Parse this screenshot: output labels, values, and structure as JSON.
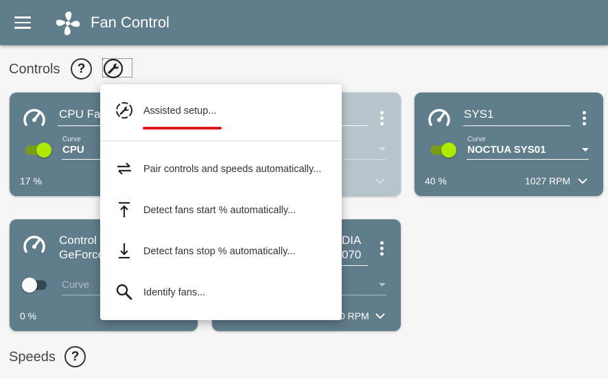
{
  "app": {
    "title": "Fan Control"
  },
  "sections": {
    "controls": "Controls",
    "speeds": "Speeds"
  },
  "help_glyph": "?",
  "cards": [
    {
      "name": "CPU Fan",
      "caption": "Curve",
      "curve": "CPU",
      "percent": "17 %",
      "rpm": "",
      "enabled": true
    },
    {
      "name": "",
      "caption": "",
      "curve": "",
      "percent": "",
      "rpm": "",
      "enabled": true
    },
    {
      "name": "SYS1",
      "caption": "Curve",
      "curve": "NOCTUA SYS01",
      "percent": "40 %",
      "rpm": "1027 RPM",
      "enabled": true
    },
    {
      "name_line1": "Control",
      "name_line2": "GeForce",
      "placeholder": "Curve",
      "percent": "0 %",
      "enabled": false
    },
    {
      "name_line1": "DIA",
      "name_line2": "070",
      "rpm": "0 RPM"
    }
  ],
  "menu": {
    "items": [
      {
        "label": "Assisted setup...",
        "icon": "assisted-setup-icon"
      },
      {
        "label": "Pair controls and speeds automatically...",
        "icon": "swap-arrows-icon"
      },
      {
        "label": "Detect fans start % automatically...",
        "icon": "arrow-up-bar-icon"
      },
      {
        "label": "Detect fans stop % automatically...",
        "icon": "arrow-down-bar-icon"
      },
      {
        "label": "Identify fans...",
        "icon": "search-icon"
      }
    ],
    "highlight_color": "#e0171f"
  },
  "colors": {
    "appbar": "#607d8b",
    "card": "#607d8b",
    "toggle_on": "#aeea00"
  }
}
